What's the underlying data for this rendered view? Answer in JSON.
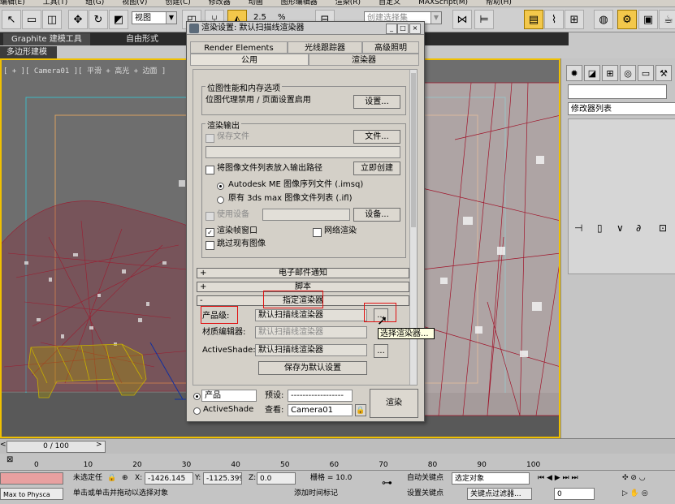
{
  "menu": {
    "items": [
      "编辑(E)",
      "工具(T)",
      "组(G)",
      "视图(V)",
      "创建(C)",
      "修改器",
      "动画",
      "图形编辑器",
      "渲染(R)",
      "自定义",
      "MAXScript(M)",
      "帮助(H)"
    ]
  },
  "toolbar": {
    "view_select": "视图",
    "snap_value": "2.5",
    "percent_label": "%",
    "selection_set_placeholder": "创建选择集"
  },
  "ribbon": {
    "tabs": [
      "Graphite 建模工具",
      "自由形式"
    ],
    "subtab": "多边形建模"
  },
  "viewport": {
    "label": "[ + ][ Camera01 ][ 平滑 + 高光 + 边面 ]"
  },
  "command_panel": {
    "modifier_list": "修改器列表"
  },
  "dialog": {
    "title": "渲染设置: 默认扫描线渲染器",
    "tabs_row1": [
      "Render Elements",
      "光线跟踪器",
      "高级照明"
    ],
    "tabs_row2": [
      "公用",
      "渲染器"
    ],
    "bitmap_group": "位图性能和内存选项",
    "bitmap_text": "位图代理禁用 / 页面设置启用",
    "bitmap_button": "设置...",
    "output_group": "渲染输出",
    "save_file_label": "保存文件",
    "file_button": "文件...",
    "put_image_label": "将图像文件列表放入输出路径",
    "create_now_button": "立即创建",
    "radio1_label": "Autodesk ME 图像序列文件 (.imsq)",
    "radio2_label": "原有 3ds max 图像文件列表 (.ifl)",
    "use_device_label": "使用设备",
    "device_button": "设备...",
    "frame_window_label": "渲染帧窗口",
    "net_render_label": "网络渲染",
    "skip_existing_label": "跳过现有图像",
    "rollout_email": "电子邮件通知",
    "rollout_script": "脚本",
    "rollout_assign": "指定渲染器",
    "production_label": "产品级:",
    "production_value": "默认扫描线渲染器",
    "material_label": "材质编辑器:",
    "material_value": "默认扫描线渲染器",
    "activeshade_label": "ActiveShade:",
    "activeshade_value": "默认扫描线渲染器",
    "save_default_button": "保存为默认设置",
    "browse_button": "...",
    "footer_radio1": "产品",
    "footer_radio2": "ActiveShade",
    "preset_label": "预设:",
    "preset_value": "------------------",
    "view_label": "查看:",
    "view_value": "Camera01",
    "render_button": "渲染"
  },
  "tooltip": "选择渲染器...",
  "timeline": {
    "slider": "0 / 100",
    "ticks": [
      "0",
      "10",
      "20",
      "30",
      "40",
      "50",
      "60",
      "70",
      "80",
      "90",
      "100"
    ]
  },
  "status": {
    "unselected": "未选定任",
    "x_value": "-1426.145",
    "y_value": "-1125.399",
    "z_value": "0.0",
    "grid": "栅格 = 10.0",
    "auto_key": "自动关键点",
    "selected_object": "选定对象",
    "set_key": "设置关键点",
    "key_filter": "关键点过滤器...",
    "frame_value": "0",
    "maxscript": "Max to Physca",
    "prompt": "单击或单击并拖动以选择对象",
    "add_time_tag": "添加时间标记"
  },
  "colors": {
    "viewport_border": "#f0c000",
    "highlight_box": "#e01010",
    "tree_wire": "#a0142a",
    "cow_wire": "#c8b000"
  }
}
